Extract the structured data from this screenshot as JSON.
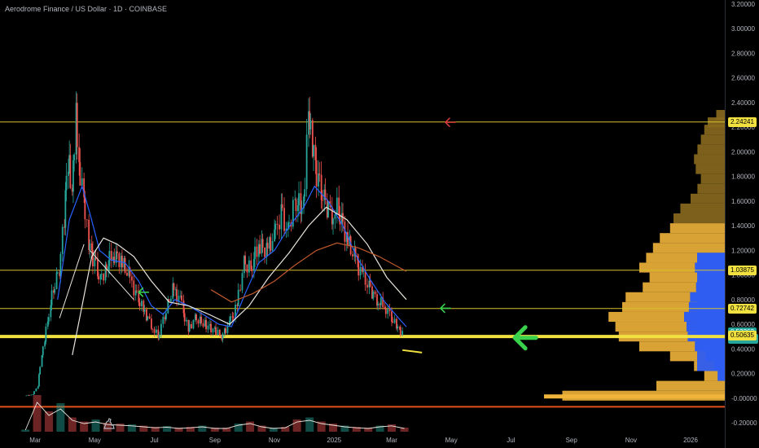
{
  "header": {
    "title": "Aerodrome Finance / US Dollar · 1D · COINBASE"
  },
  "colors": {
    "bg": "#000000",
    "candle_up": "#26a69a",
    "candle_down": "#ef5350",
    "hline": "#d6c22a",
    "support": "#f0e040",
    "bottom": "#e0501c",
    "ma_fast": "#2962ff",
    "ma_mid": "#e9e4dc",
    "ma_slow": "#c0582c",
    "arrow_green": "#3ad24c",
    "arrow_red": "#d23a3a",
    "vp_blue": "#2f5df0",
    "vp_yellow": "#f0b43a",
    "vp_dark": "#8a6a1e"
  },
  "chart_data": {
    "type": "candlestick",
    "title": "Aerodrome Finance / US Dollar · 1D · COINBASE",
    "ylim": [
      -0.3,
      3.2
    ],
    "y_ticks": [
      "3.20000",
      "3.00000",
      "2.80000",
      "2.60000",
      "2.40000",
      "2.20000",
      "2.00000",
      "1.80000",
      "1.60000",
      "1.40000",
      "1.20000",
      "1.00000",
      "0.80000",
      "0.60000",
      "0.40000",
      "0.20000",
      "-0.00000",
      "-0.20000"
    ],
    "y_tick_values": [
      3.2,
      3.0,
      2.8,
      2.6,
      2.4,
      2.2,
      2.0,
      1.8,
      1.6,
      1.4,
      1.2,
      1.0,
      0.8,
      0.6,
      0.4,
      0.2,
      0.0,
      -0.2
    ],
    "x_ticks": [
      "Mar",
      "May",
      "Jul",
      "Sep",
      "Nov",
      "2025",
      "Mar",
      "May",
      "Jul",
      "Sep",
      "Nov",
      "2026"
    ],
    "x_tick_dates": [
      "2024-03-01",
      "2024-05-01",
      "2024-07-01",
      "2024-09-01",
      "2024-11-01",
      "2025-01-01",
      "2025-03-01",
      "2025-05-01",
      "2025-07-01",
      "2025-09-01",
      "2025-11-01",
      "2026-01-01"
    ],
    "x_range": [
      "2024-01-25",
      "2026-02-05"
    ],
    "horizontal_lines": [
      {
        "value": 2.24241,
        "label": "2.24241",
        "style": "thin"
      },
      {
        "value": 1.03875,
        "label": "1.03875",
        "style": "thin"
      },
      {
        "value": 0.72742,
        "label": "0.72742",
        "style": "thin"
      },
      {
        "value": 0.5,
        "label": "",
        "style": "thick"
      },
      {
        "value": -0.07,
        "label": "",
        "style": "bottom"
      }
    ],
    "price_labels": [
      {
        "value": 2.24241,
        "text": "2.24241",
        "kind": "level"
      },
      {
        "value": 1.03875,
        "text": "1.03875",
        "kind": "level"
      },
      {
        "value": 0.72742,
        "text": "0.72742",
        "kind": "level"
      },
      {
        "value": 0.53363,
        "text": "0.53363",
        "kind": "current"
      },
      {
        "value": 0.48,
        "text": "04:18:37",
        "kind": "countdown"
      },
      {
        "value": 0.50635,
        "text": "0.50635",
        "kind": "level"
      }
    ],
    "close_path": [
      [
        "2024-02-20",
        0.02
      ],
      [
        "2024-02-28",
        0.03
      ],
      [
        "2024-03-04",
        0.1
      ],
      [
        "2024-03-08",
        0.35
      ],
      [
        "2024-03-14",
        0.62
      ],
      [
        "2024-03-20",
        0.9
      ],
      [
        "2024-03-26",
        1.05
      ],
      [
        "2024-03-31",
        1.45
      ],
      [
        "2024-04-04",
        1.95
      ],
      [
        "2024-04-08",
        1.7
      ],
      [
        "2024-04-12",
        2.3
      ],
      [
        "2024-04-15",
        1.95
      ],
      [
        "2024-04-20",
        1.6
      ],
      [
        "2024-04-25",
        1.25
      ],
      [
        "2024-05-01",
        1.1
      ],
      [
        "2024-05-07",
        0.95
      ],
      [
        "2024-05-12",
        1.05
      ],
      [
        "2024-05-20",
        1.18
      ],
      [
        "2024-05-28",
        1.12
      ],
      [
        "2024-06-05",
        1.0
      ],
      [
        "2024-06-12",
        0.85
      ],
      [
        "2024-06-20",
        0.72
      ],
      [
        "2024-06-28",
        0.6
      ],
      [
        "2024-07-05",
        0.5
      ],
      [
        "2024-07-12",
        0.68
      ],
      [
        "2024-07-20",
        0.88
      ],
      [
        "2024-07-28",
        0.8
      ],
      [
        "2024-08-05",
        0.55
      ],
      [
        "2024-08-12",
        0.65
      ],
      [
        "2024-08-22",
        0.6
      ],
      [
        "2024-09-01",
        0.55
      ],
      [
        "2024-09-08",
        0.5
      ],
      [
        "2024-09-16",
        0.6
      ],
      [
        "2024-09-24",
        0.75
      ],
      [
        "2024-10-01",
        1.1
      ],
      [
        "2024-10-08",
        1.05
      ],
      [
        "2024-10-16",
        1.25
      ],
      [
        "2024-10-24",
        1.2
      ],
      [
        "2024-11-01",
        1.3
      ],
      [
        "2024-11-08",
        1.5
      ],
      [
        "2024-11-15",
        1.35
      ],
      [
        "2024-11-22",
        1.6
      ],
      [
        "2024-12-01",
        1.55
      ],
      [
        "2024-12-06",
        2.3
      ],
      [
        "2024-12-10",
        2.05
      ],
      [
        "2024-12-16",
        1.75
      ],
      [
        "2024-12-22",
        1.6
      ],
      [
        "2024-12-30",
        1.5
      ],
      [
        "2025-01-06",
        1.55
      ],
      [
        "2025-01-14",
        1.3
      ],
      [
        "2025-01-22",
        1.15
      ],
      [
        "2025-01-30",
        1.0
      ],
      [
        "2025-02-06",
        0.9
      ],
      [
        "2025-02-14",
        0.8
      ],
      [
        "2025-02-22",
        0.75
      ],
      [
        "2025-03-01",
        0.66
      ],
      [
        "2025-03-06",
        0.58
      ],
      [
        "2025-03-12",
        0.53363
      ]
    ],
    "series": [
      {
        "kind": "moving_average_fast",
        "points": [
          [
            "2024-03-24",
            0.8
          ],
          [
            "2024-04-05",
            1.45
          ],
          [
            "2024-04-18",
            1.72
          ],
          [
            "2024-04-26",
            1.5
          ],
          [
            "2024-05-06",
            1.2
          ],
          [
            "2024-05-18",
            1.12
          ],
          [
            "2024-06-01",
            1.1
          ],
          [
            "2024-06-15",
            0.95
          ],
          [
            "2024-06-28",
            0.75
          ],
          [
            "2024-07-10",
            0.68
          ],
          [
            "2024-07-22",
            0.8
          ],
          [
            "2024-08-05",
            0.75
          ],
          [
            "2024-08-20",
            0.68
          ],
          [
            "2024-09-05",
            0.6
          ],
          [
            "2024-09-18",
            0.58
          ],
          [
            "2024-10-02",
            0.85
          ],
          [
            "2024-10-16",
            1.1
          ],
          [
            "2024-11-01",
            1.2
          ],
          [
            "2024-11-15",
            1.38
          ],
          [
            "2024-12-01",
            1.55
          ],
          [
            "2024-12-12",
            1.72
          ],
          [
            "2024-12-26",
            1.6
          ],
          [
            "2025-01-10",
            1.4
          ],
          [
            "2025-01-24",
            1.15
          ],
          [
            "2025-02-08",
            0.95
          ],
          [
            "2025-02-22",
            0.78
          ],
          [
            "2025-03-08",
            0.65
          ],
          [
            "2025-03-16",
            0.58
          ]
        ]
      },
      {
        "kind": "moving_average_mid",
        "points": [
          [
            "2024-04-08",
            0.35
          ],
          [
            "2024-04-18",
            0.75
          ],
          [
            "2024-04-28",
            1.15
          ],
          [
            "2024-05-10",
            1.3
          ],
          [
            "2024-05-24",
            1.25
          ],
          [
            "2024-06-10",
            1.15
          ],
          [
            "2024-06-28",
            0.95
          ],
          [
            "2024-07-16",
            0.78
          ],
          [
            "2024-08-05",
            0.75
          ],
          [
            "2024-08-26",
            0.68
          ],
          [
            "2024-09-16",
            0.6
          ],
          [
            "2024-10-06",
            0.75
          ],
          [
            "2024-10-26",
            0.98
          ],
          [
            "2024-11-16",
            1.18
          ],
          [
            "2024-12-06",
            1.4
          ],
          [
            "2024-12-24",
            1.55
          ],
          [
            "2025-01-14",
            1.45
          ],
          [
            "2025-02-04",
            1.25
          ],
          [
            "2025-02-24",
            0.98
          ],
          [
            "2025-03-16",
            0.8
          ]
        ]
      },
      {
        "kind": "moving_average_slow",
        "points": [
          [
            "2024-08-28",
            0.88
          ],
          [
            "2024-09-18",
            0.78
          ],
          [
            "2024-10-10",
            0.85
          ],
          [
            "2024-11-01",
            0.95
          ],
          [
            "2024-11-22",
            1.08
          ],
          [
            "2024-12-14",
            1.2
          ],
          [
            "2025-01-04",
            1.26
          ],
          [
            "2025-01-26",
            1.22
          ],
          [
            "2025-02-16",
            1.15
          ],
          [
            "2025-03-16",
            1.03
          ]
        ]
      }
    ],
    "annotations": [
      {
        "type": "arrow",
        "direction": "left",
        "color": "red",
        "x": "2025-04-25",
        "y": 2.24,
        "size": "small"
      },
      {
        "type": "arrow",
        "direction": "left",
        "color": "green",
        "x": "2024-06-15",
        "y": 0.86,
        "size": "small"
      },
      {
        "type": "arrow",
        "direction": "left",
        "color": "green",
        "x": "2025-04-20",
        "y": 0.73,
        "size": "small"
      },
      {
        "type": "arrow",
        "direction": "left",
        "color": "green",
        "x": "2025-07-05",
        "y": 0.49,
        "size": "large"
      },
      {
        "type": "trendline",
        "from": [
          "2024-04-26",
          1.2
        ],
        "to": [
          "2024-06-10",
          0.8
        ]
      },
      {
        "type": "trendline",
        "from": [
          "2024-03-26",
          0.65
        ],
        "to": [
          "2024-04-20",
          1.25
        ]
      },
      {
        "type": "segment",
        "from": [
          "2025-03-12",
          0.39
        ],
        "to": [
          "2025-04-01",
          0.37
        ]
      }
    ],
    "volume_profile": {
      "bins": [
        [
          2.3,
          0.05
        ],
        [
          2.24,
          0.1
        ],
        [
          2.18,
          0.12
        ],
        [
          2.1,
          0.14
        ],
        [
          2.02,
          0.16
        ],
        [
          1.94,
          0.18
        ],
        [
          1.86,
          0.17
        ],
        [
          1.78,
          0.14
        ],
        [
          1.7,
          0.16
        ],
        [
          1.62,
          0.2
        ],
        [
          1.54,
          0.26
        ],
        [
          1.46,
          0.3
        ],
        [
          1.38,
          0.32
        ],
        [
          1.3,
          0.38
        ],
        [
          1.22,
          0.42
        ],
        [
          1.14,
          0.46
        ],
        [
          1.06,
          0.5
        ],
        [
          0.98,
          0.44
        ],
        [
          0.9,
          0.48
        ],
        [
          0.82,
          0.58
        ],
        [
          0.74,
          0.6
        ],
        [
          0.66,
          0.68
        ],
        [
          0.58,
          0.64
        ],
        [
          0.5,
          0.62
        ],
        [
          0.42,
          0.5
        ],
        [
          0.34,
          0.32
        ],
        [
          0.26,
          0.18
        ],
        [
          0.18,
          0.12
        ],
        [
          0.1,
          0.4
        ],
        [
          0.02,
          0.95
        ]
      ]
    },
    "volume": {
      "ylim": [
        0,
        1
      ],
      "values": [
        0.05,
        0.9,
        0.5,
        0.7,
        0.35,
        0.25,
        0.3,
        0.22,
        0.2,
        0.18,
        0.15,
        0.12,
        0.14,
        0.1,
        0.12,
        0.15,
        0.1,
        0.1,
        0.2,
        0.25,
        0.15,
        0.1,
        0.12,
        0.3,
        0.35,
        0.25,
        0.2,
        0.15,
        0.12,
        0.1,
        0.15,
        0.18,
        0.1
      ],
      "start": "2024-02-20",
      "end": "2025-03-14"
    }
  }
}
